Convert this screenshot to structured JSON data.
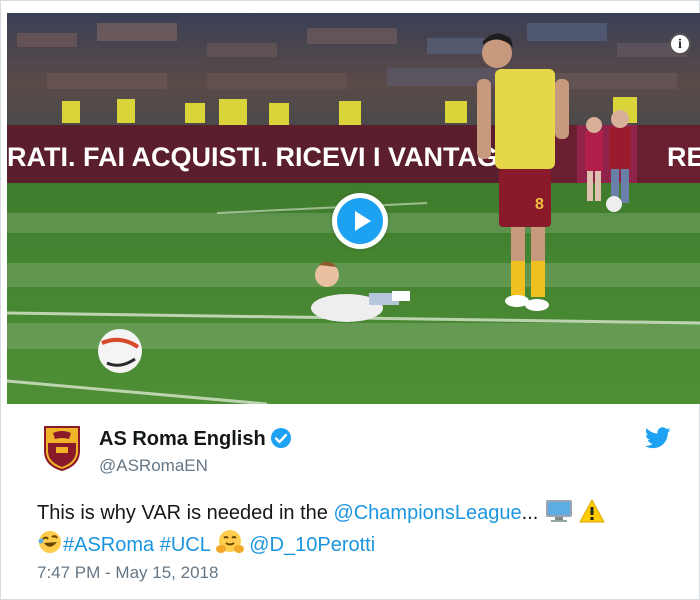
{
  "media": {
    "banner_left": "RATI. FAI ACQUISTI. RICEVI I VANTAGGI!",
    "banner_right": "RE",
    "player_number": "8",
    "info_symbol": "i"
  },
  "tweet": {
    "author_name": "AS Roma English",
    "author_handle": "@ASRomaEN",
    "text_prefix": "This is why VAR is needed in the ",
    "mention_1": "@ChampionsLeague",
    "ellipsis": "...",
    "hashtag_1": "#ASRoma",
    "hashtag_2": "#UCL",
    "mention_2": "@D_10Perotti",
    "timestamp": "7:47 PM - May 15, 2018"
  },
  "colors": {
    "link": "#1b95e0",
    "twitter_blue": "#1da1f2",
    "text": "#14171a",
    "secondary": "#657786"
  },
  "icons": [
    "info-icon",
    "play-icon",
    "verified-badge-icon",
    "twitter-bird-icon",
    "computer-emoji",
    "warning-emoji",
    "laughing-emoji",
    "hugging-emoji"
  ]
}
